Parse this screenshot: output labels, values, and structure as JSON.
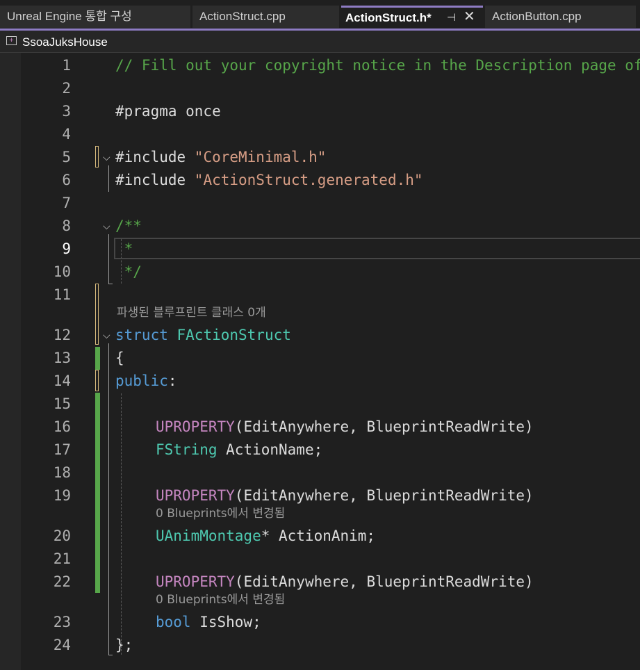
{
  "tabs": [
    {
      "label": "Unreal Engine 통합 구성",
      "active": false
    },
    {
      "label": "ActionStruct.cpp",
      "active": false
    },
    {
      "label": "ActionStruct.h*",
      "active": true
    },
    {
      "label": "ActionButton.cpp",
      "active": false
    }
  ],
  "active_tab_icons": {
    "pin": "pin-icon",
    "close": "close-icon"
  },
  "navbar": {
    "project_icon": "cpp-project-icon",
    "project_name": "SsoaJuksHouse"
  },
  "colors": {
    "accent": "#8e7cc3",
    "comment": "#57a64a",
    "keyword": "#569cd6",
    "string": "#d69d85",
    "type": "#4ec9b0",
    "macro": "#c586c0",
    "change_saved": "#57a64a",
    "change_unsaved": "#d7ba7d"
  },
  "editor": {
    "current_line": "9",
    "line_numbers": [
      "1",
      "2",
      "3",
      "4",
      "5",
      "6",
      "7",
      "8",
      "9",
      "10",
      "11",
      "12",
      "13",
      "14",
      "15",
      "16",
      "17",
      "18",
      "19",
      "20",
      "21",
      "22",
      "23",
      "24"
    ],
    "lines": {
      "l1": {
        "comment": "// Fill out your copyright notice in the Description page of Project Settings."
      },
      "l3": {
        "pragma": "#pragma once"
      },
      "l5": {
        "directive": "#include ",
        "path": "\"CoreMinimal.h\""
      },
      "l6": {
        "directive": "#include ",
        "path": "\"ActionStruct.generated.h\""
      },
      "l8": {
        "doc": "/**"
      },
      "l9": {
        "doc": " *"
      },
      "l10": {
        "doc": " */"
      },
      "l12": {
        "kw": "struct ",
        "name": "FActionStruct"
      },
      "l13": {
        "text": "{"
      },
      "l14": {
        "kw": "public",
        "rest": ":"
      },
      "l16": {
        "macro": "UPROPERTY",
        "args": "(EditAnywhere, BlueprintReadWrite)"
      },
      "l17": {
        "type": "FString",
        "rest": " ActionName;"
      },
      "l19": {
        "macro": "UPROPERTY",
        "args": "(EditAnywhere, BlueprintReadWrite)"
      },
      "l20": {
        "type": "UAnimMontage",
        "rest": "* ActionAnim;"
      },
      "l22": {
        "macro": "UPROPERTY",
        "args": "(EditAnywhere, BlueprintReadWrite)"
      },
      "l23": {
        "kw": "bool",
        "rest": " IsShow;"
      },
      "l24": {
        "text": "};"
      }
    },
    "hints": {
      "struct_hint": "파생된 블루프린트 클래스 0개",
      "prop_hint_1": "0 Blueprints에서 변경됨",
      "prop_hint_2": "0 Blueprints에서 변경됨"
    }
  }
}
